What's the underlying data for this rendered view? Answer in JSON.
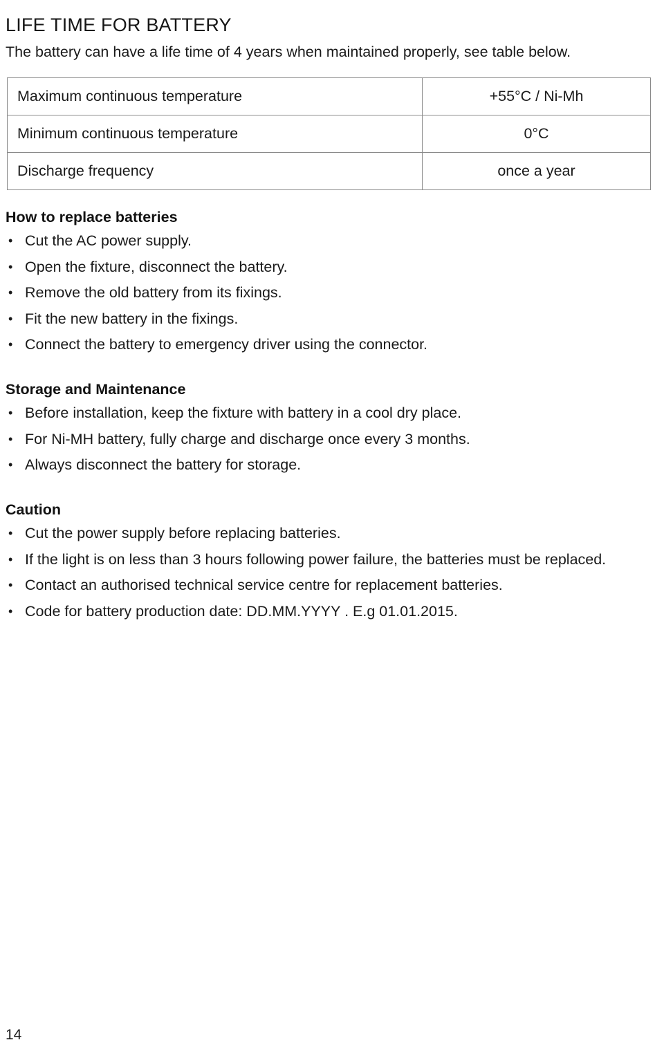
{
  "document": {
    "title": "LIFE TIME FOR BATTERY",
    "intro": "The battery can have a life time of 4 years when maintained properly, see table below.",
    "page_number": "14"
  },
  "spec_table": {
    "rows": [
      {
        "label": "Maximum continuous temperature",
        "value": "+55°C / Ni-Mh"
      },
      {
        "label": "Minimum continuous temperature",
        "value": "0°C"
      },
      {
        "label": "Discharge frequency",
        "value": "once a year"
      }
    ]
  },
  "sections": [
    {
      "heading": "How to replace batteries",
      "items": [
        "Cut the AC power supply.",
        "Open the fixture, disconnect the battery.",
        "Remove the old battery from its fixings.",
        "Fit the new battery in the fixings.",
        "Connect the battery to emergency driver using the connector."
      ]
    },
    {
      "heading": "Storage and Maintenance",
      "items": [
        "Before installation, keep the fixture with battery in a cool dry place.",
        "For Ni-MH battery, fully charge and discharge once every 3 months.",
        "Always disconnect the battery for storage."
      ]
    },
    {
      "heading": "Caution",
      "items": [
        "Cut the power supply before replacing batteries.",
        "If the light is on less than 3 hours following power failure, the batteries must be replaced.",
        "Contact an authorised technical service centre for replacement batteries.",
        "Code for battery production date: DD.MM.YYYY . E.g 01.01.2015."
      ]
    }
  ],
  "colors": {
    "text": "#1a1a1a",
    "table_border": "#8a8a8a",
    "background": "#ffffff"
  }
}
